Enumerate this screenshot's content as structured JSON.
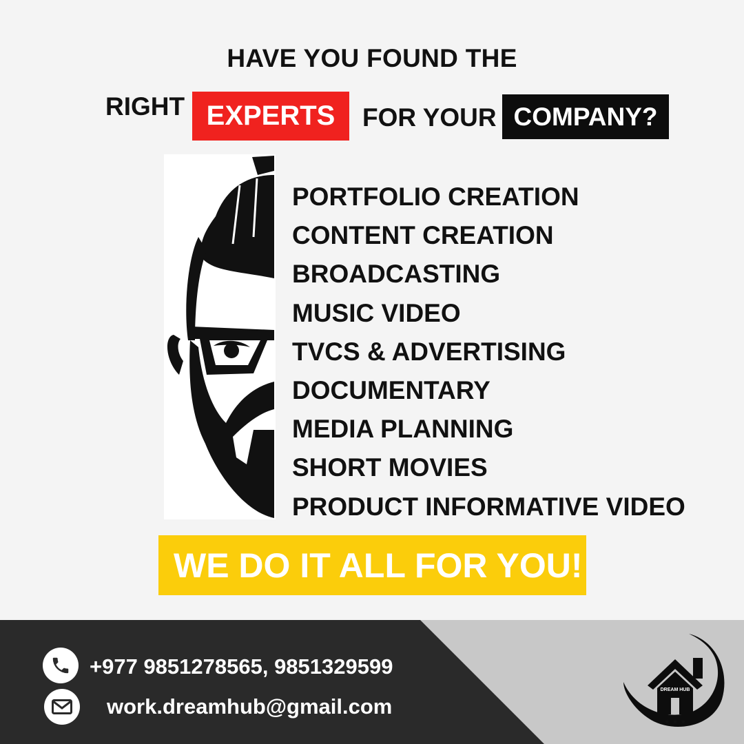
{
  "headline": {
    "line1": "HAVE YOU FOUND THE",
    "right": "RIGHT",
    "experts": "EXPERTS",
    "for_your": "FOR YOUR",
    "company": "COMPANY?"
  },
  "services": [
    "PORTFOLIO CREATION",
    "CONTENT CREATION",
    "BROADCASTING",
    "MUSIC VIDEO",
    "TVCS & ADVERTISING",
    "DOCUMENTARY",
    "MEDIA PLANNING",
    "SHORT MOVIES",
    "PRODUCT INFORMATIVE VIDEO"
  ],
  "cta": "WE DO IT ALL FOR YOU!",
  "contact": {
    "phone": "+977 9851278565, 9851329599",
    "email": "work.dreamhub@gmail.com"
  },
  "logo": {
    "text": "DREAM HUB"
  },
  "colors": {
    "red": "#f0221f",
    "yellow": "#fbcd0b",
    "footer_dark": "#2a2a2a",
    "footer_light": "#c8c8c8"
  }
}
